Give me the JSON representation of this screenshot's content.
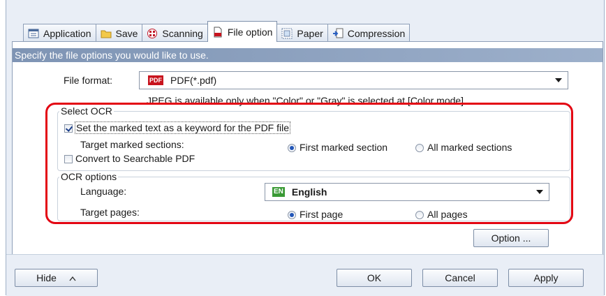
{
  "tabs": [
    {
      "label": "Application",
      "icon": "application-icon"
    },
    {
      "label": "Save",
      "icon": "folder-icon"
    },
    {
      "label": "Scanning",
      "icon": "scanning-icon"
    },
    {
      "label": "File option",
      "icon": "file-option-icon",
      "active": true
    },
    {
      "label": "Paper",
      "icon": "paper-icon"
    },
    {
      "label": "Compression",
      "icon": "compression-icon"
    }
  ],
  "banner": "Specify the file options you would like to use.",
  "file_format": {
    "label": "File format:",
    "badge": "PDF",
    "value": "PDF(*.pdf)",
    "note": "JPEG is available only when \"Color\" or \"Gray\" is selected at [Color mode]"
  },
  "select_ocr": {
    "title": "Select OCR",
    "keyword_checkbox": "Set the marked text as a keyword for the PDF file",
    "keyword_checked": true,
    "target_marked_label": "Target marked sections:",
    "first_marked": "First marked section",
    "all_marked": "All marked sections",
    "searchable_checkbox": "Convert to Searchable PDF",
    "searchable_checked": false
  },
  "ocr_options": {
    "title": "OCR options",
    "language_label": "Language:",
    "language_badge": "EN",
    "language_value": "English",
    "target_pages_label": "Target pages:",
    "first_page": "First page",
    "all_pages": "All pages"
  },
  "buttons": {
    "option": "Option ...",
    "hide": "Hide",
    "ok": "OK",
    "cancel": "Cancel",
    "apply": "Apply"
  },
  "colors": {
    "highlight": "#e30613",
    "banner": "#8aa0bf",
    "pdf_badge": "#c8141e",
    "en_badge": "#3a9a35"
  }
}
